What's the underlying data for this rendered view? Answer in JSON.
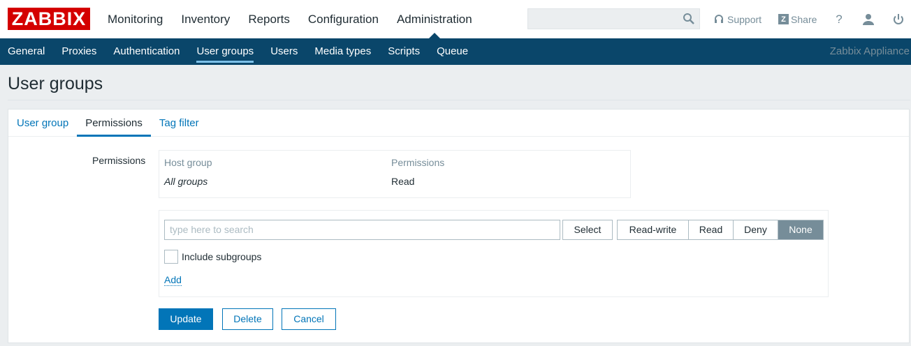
{
  "logo": {
    "text": "ZABBIX"
  },
  "main_nav": [
    {
      "label": "Monitoring"
    },
    {
      "label": "Inventory"
    },
    {
      "label": "Reports"
    },
    {
      "label": "Configuration"
    },
    {
      "label": "Administration",
      "active": true
    }
  ],
  "search": {
    "placeholder": "",
    "value": ""
  },
  "top_links": {
    "support": "Support",
    "share": "Share",
    "help": "?"
  },
  "sub_nav": [
    {
      "label": "General"
    },
    {
      "label": "Proxies"
    },
    {
      "label": "Authentication"
    },
    {
      "label": "User groups",
      "active": true
    },
    {
      "label": "Users"
    },
    {
      "label": "Media types"
    },
    {
      "label": "Scripts"
    },
    {
      "label": "Queue"
    }
  ],
  "server_name": "Zabbix Appliance",
  "page_title": "User groups",
  "tabs": [
    {
      "label": "User group"
    },
    {
      "label": "Permissions",
      "active": true
    },
    {
      "label": "Tag filter"
    }
  ],
  "form": {
    "permissions_label": "Permissions",
    "table": {
      "headers": [
        "Host group",
        "Permissions"
      ],
      "rows": [
        {
          "host_group": "All groups",
          "permission": "Read"
        }
      ]
    },
    "add": {
      "search_placeholder": "type here to search",
      "select_label": "Select",
      "permission_options": [
        "Read-write",
        "Read",
        "Deny",
        "None"
      ],
      "selected_permission": "None",
      "include_subgroups_label": "Include subgroups",
      "include_subgroups_checked": false,
      "add_link": "Add"
    },
    "buttons": {
      "update": "Update",
      "delete": "Delete",
      "cancel": "Cancel"
    }
  },
  "colors": {
    "brand_red": "#d40000",
    "nav_blue": "#0a466a",
    "link_blue": "#0275b8",
    "selected_segment": "#768d99"
  }
}
